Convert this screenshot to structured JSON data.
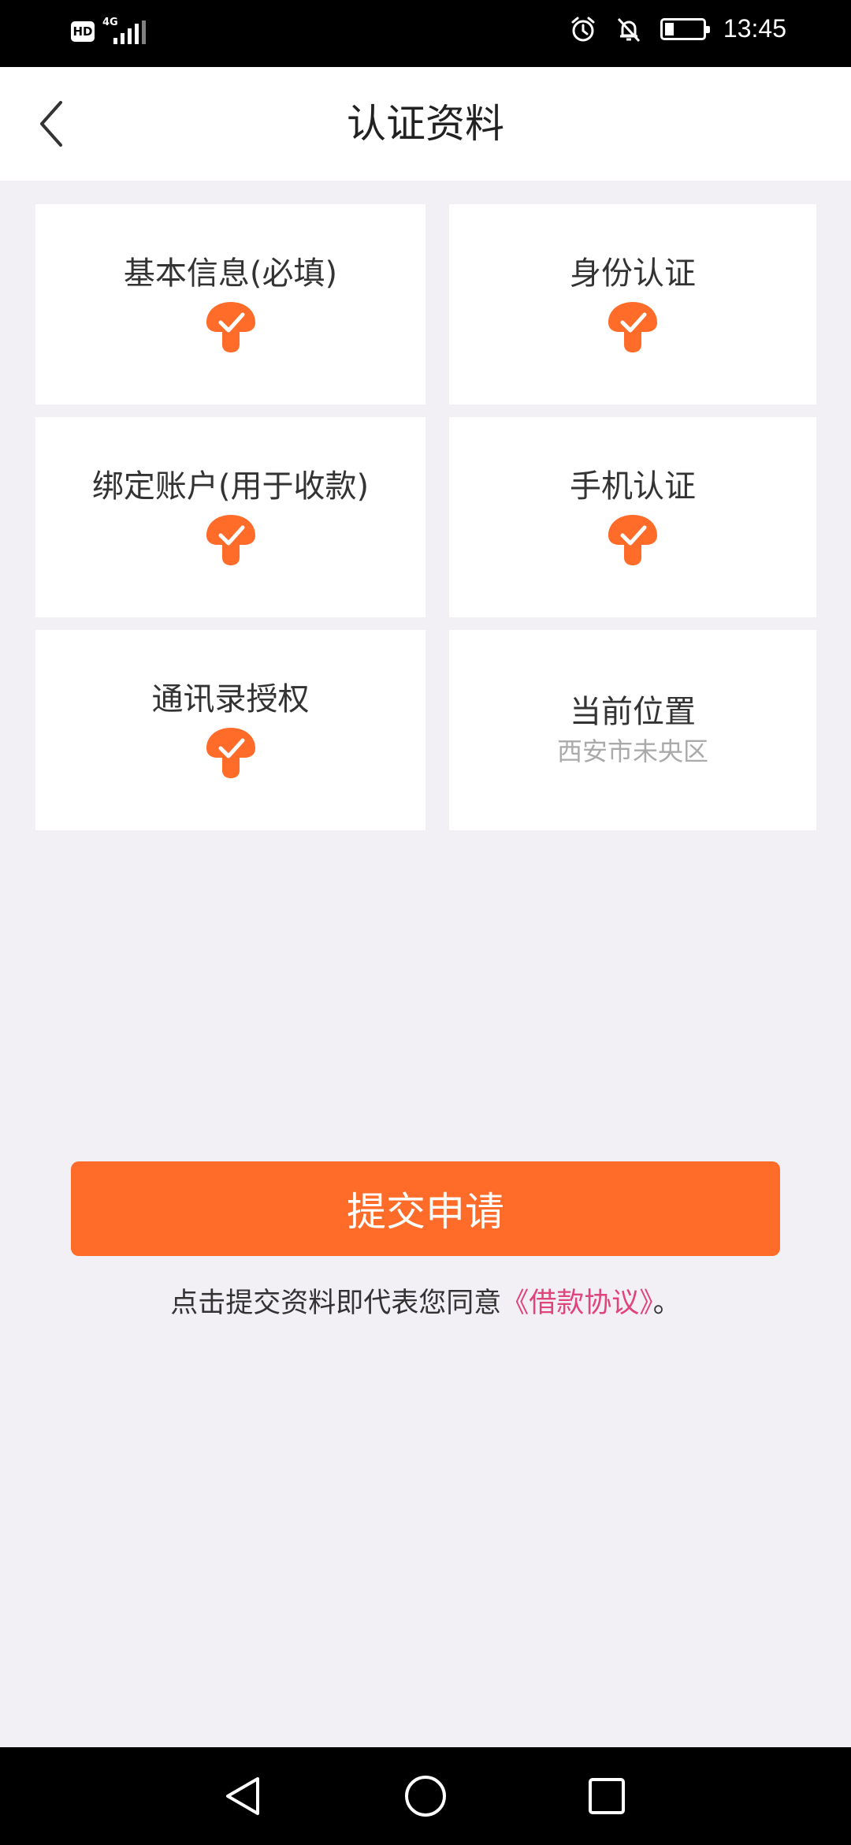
{
  "status_bar": {
    "hd": "HD",
    "network": "4G",
    "time": "13:45",
    "icons": [
      "alarm-icon",
      "bell-muted-icon",
      "battery-charging-icon"
    ]
  },
  "header": {
    "title": "认证资料",
    "back_icon": "chevron-left-icon"
  },
  "cards": [
    {
      "title": "基本信息(必填)",
      "verified": true
    },
    {
      "title": "身份认证",
      "verified": true
    },
    {
      "title": "绑定账户(用于收款)",
      "verified": true
    },
    {
      "title": "手机认证",
      "verified": true
    },
    {
      "title": "通讯录授权",
      "verified": true
    },
    {
      "title": "当前位置",
      "subtitle": "西安市未央区",
      "verified": false
    }
  ],
  "submit": {
    "label": "提交申请"
  },
  "agreement": {
    "prefix": "点击提交资料即代表您同意",
    "link": "《借款协议》",
    "suffix": "。"
  },
  "colors": {
    "accent": "#ff6c2a",
    "link": "#e0457a",
    "background": "#f2f0f5"
  }
}
